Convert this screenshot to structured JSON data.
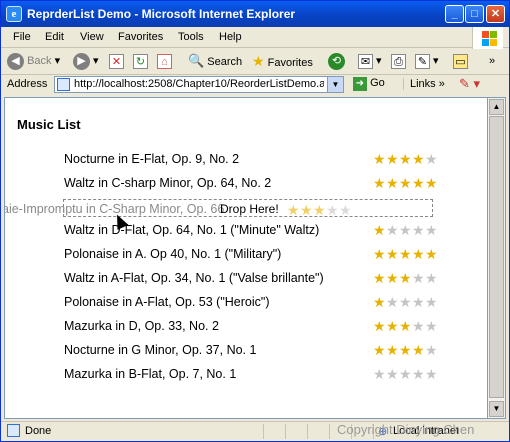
{
  "window": {
    "title": "ReprderList Demo - Microsoft Internet Explorer"
  },
  "titlebar_buttons": {
    "minimize": "_",
    "maximize": "□",
    "close": "✕"
  },
  "menu": [
    "File",
    "Edit",
    "View",
    "Favorites",
    "Tools",
    "Help"
  ],
  "toolbar": {
    "back": "Back",
    "search": "Search",
    "favorites": "Favorites"
  },
  "address": {
    "label": "Address",
    "url": "http://localhost:2508/Chapter10/ReorderListDemo.a",
    "go": "Go",
    "links": "Links"
  },
  "page": {
    "heading": "Music List",
    "drop_text": "Drop Here!",
    "dragging_item": "aie-Impromptu in C-Sharp Minor, Op. 66",
    "items": [
      {
        "title": "Nocturne in E-Flat, Op. 9, No. 2",
        "rating": 4
      },
      {
        "title": "Waltz in C-sharp Minor, Op. 64, No. 2",
        "rating": 5
      },
      {
        "title": "Waltz in D-Flat, Op. 64, No. 1 (\"Minute\" Waltz)",
        "rating": 1
      },
      {
        "title": "Polonaise in A. Op 40, No. 1 (\"Military\")",
        "rating": 5
      },
      {
        "title": "Waltz in A-Flat, Op. 34, No. 1 (\"Valse brillante\")",
        "rating": 3
      },
      {
        "title": "Polonaise in A-Flat, Op. 53 (\"Heroic\")",
        "rating": 1
      },
      {
        "title": "Mazurka in D, Op. 33, No. 2",
        "rating": 3
      },
      {
        "title": "Nocturne in G Minor, Op. 37, No. 1",
        "rating": 4
      },
      {
        "title": "Mazurka in B-Flat, Op. 7, No. 1",
        "rating": 0
      }
    ],
    "ghost_rating": 3,
    "max_rating": 5
  },
  "status": {
    "text": "Done",
    "zone": "Local intranet"
  },
  "watermark": "Copyright Dinying Chen",
  "colors": {
    "star_on": "#e8b200",
    "star_off": "#c4c4c4",
    "title_bar": "#0a5cf0"
  }
}
